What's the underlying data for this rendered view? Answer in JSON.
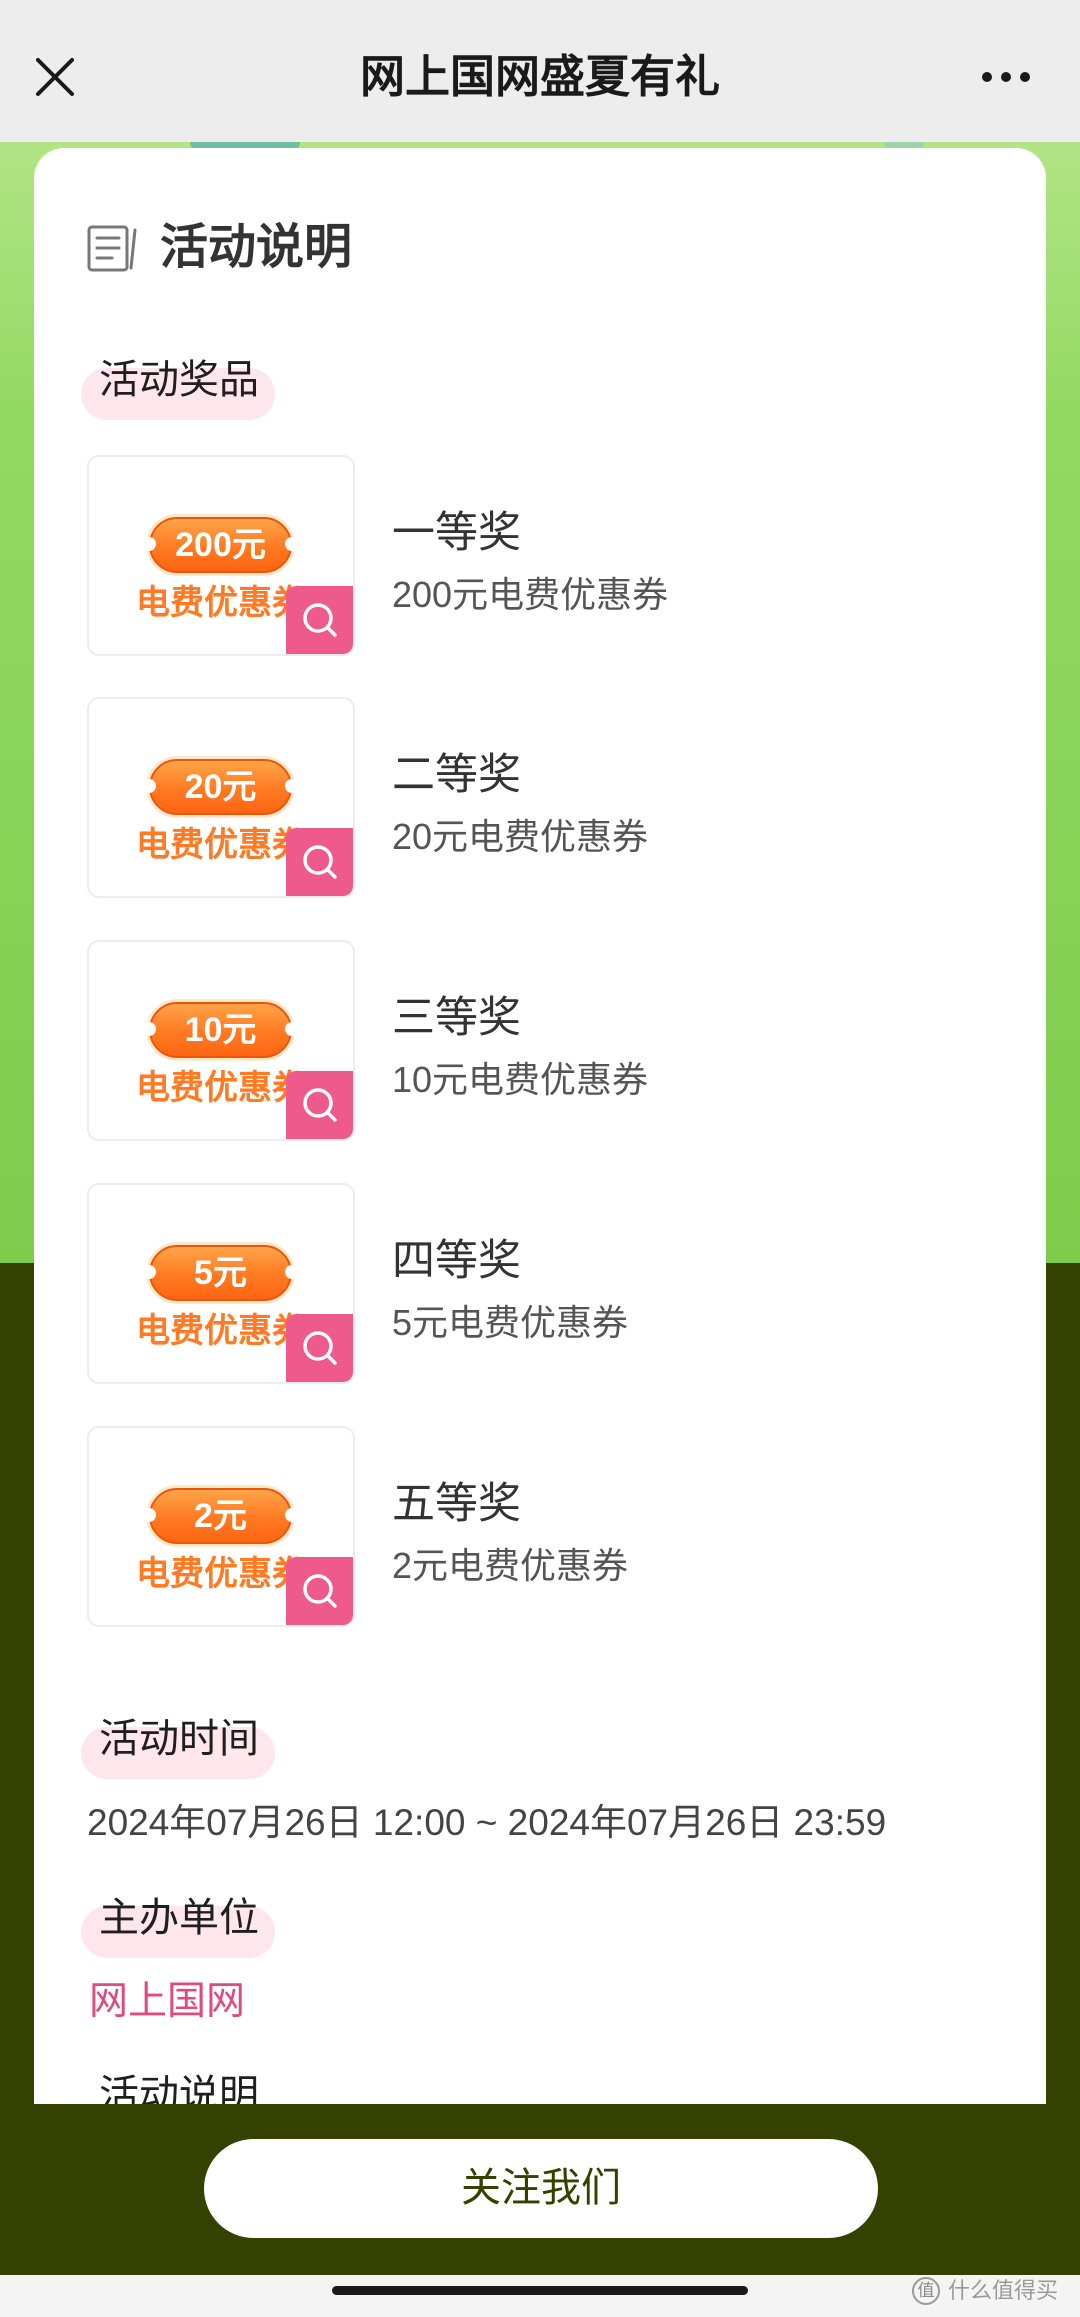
{
  "header": {
    "title": "网上国网盛夏有礼",
    "close_icon": "close-icon",
    "more_icon": "more-icon"
  },
  "card": {
    "title": "活动说明",
    "title_icon": "document-icon"
  },
  "prizes": {
    "label": "活动奖品",
    "zoom_icon": "magnifier-icon",
    "items": [
      {
        "level": "一等奖",
        "description": "200元电费优惠券",
        "ticket_amount": "200元",
        "ticket_text": "电费优惠券"
      },
      {
        "level": "二等奖",
        "description": "20元电费优惠券",
        "ticket_amount": "20元",
        "ticket_text": "电费优惠券"
      },
      {
        "level": "三等奖",
        "description": "10元电费优惠券",
        "ticket_amount": "10元",
        "ticket_text": "电费优惠券"
      },
      {
        "level": "四等奖",
        "description": "5元电费优惠券",
        "ticket_amount": "5元",
        "ticket_text": "电费优惠券"
      },
      {
        "level": "五等奖",
        "description": "2元电费优惠券",
        "ticket_amount": "2元",
        "ticket_text": "电费优惠券"
      }
    ]
  },
  "time": {
    "label": "活动时间",
    "value": "2024年07月26日 12:00 ~ 2024年07月26日 23:59"
  },
  "organizer": {
    "label": "主办单位",
    "value": "网上国网"
  },
  "description": {
    "label": "活动说明"
  },
  "footer": {
    "follow_button": "关注我们"
  },
  "watermark": {
    "logo": "值",
    "text": "什么值得买"
  },
  "colors": {
    "top_bar": "#ededed",
    "page_green": "#8ed45c",
    "page_dark": "#344200",
    "label_highlight": "#fde6ec",
    "accent_pink": "#e04a7f",
    "ticket_orange": "#ff7a22",
    "zoom_badge": "#ef5a8c"
  }
}
